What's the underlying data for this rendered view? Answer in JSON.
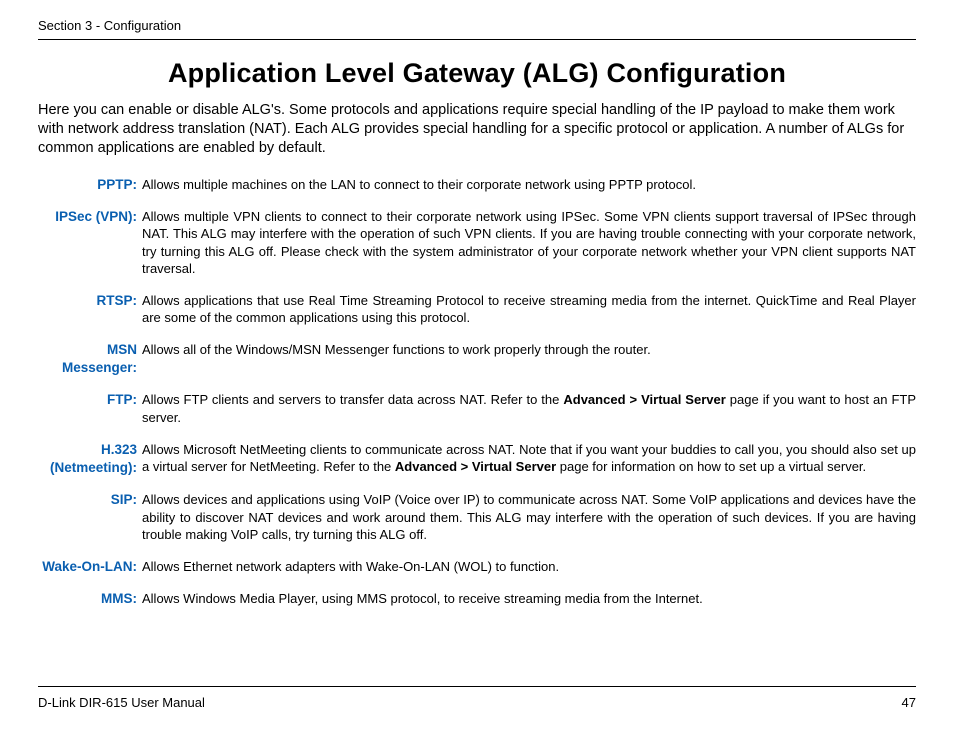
{
  "header": {
    "section": "Section 3 - Configuration"
  },
  "title": "Application Level Gateway (ALG) Configuration",
  "intro": "Here you can enable or disable ALG's. Some protocols and applications require special handling of the IP payload to make them work with network address translation (NAT). Each ALG provides special handling for a specific protocol or application. A number of ALGs for common applications are enabled by default.",
  "items": [
    {
      "label": "PPTP:",
      "desc": "Allows multiple machines on the LAN to connect to their corporate network using PPTP protocol."
    },
    {
      "label": "IPSec (VPN):",
      "desc": "Allows multiple VPN clients to connect to their corporate network using IPSec. Some VPN clients support traversal of IPSec through NAT. This ALG may interfere with the operation of such VPN clients. If you are having trouble connecting with your corporate network, try turning this ALG off. Please check with the system administrator of your corporate network whether your VPN client supports NAT traversal."
    },
    {
      "label": "RTSP:",
      "desc": "Allows applications that use Real Time Streaming Protocol to receive streaming media from the internet. QuickTime and Real Player are some of the common applications using this protocol."
    },
    {
      "label": "MSN Messenger:",
      "desc": "Allows all of the Windows/MSN Messenger functions to work properly through the router."
    },
    {
      "label": "FTP:",
      "desc_html": "Allows FTP clients and servers to transfer data across NAT. Refer to the <b>Advanced > Virtual Server</b> page if you want to host an FTP server."
    },
    {
      "label": "H.323 (Netmeeting):",
      "desc_html": "Allows Microsoft NetMeeting clients to communicate across NAT. Note that if you want your buddies to call you, you should also set up a virtual server for NetMeeting. Refer to the <b>Advanced > Virtual Server</b> page for information on how to set up a virtual server."
    },
    {
      "label": "SIP:",
      "desc": "Allows devices and applications using VoIP (Voice over IP) to communicate across NAT. Some VoIP applications and devices have the ability to discover NAT devices and work around them. This ALG may interfere with the operation of such devices. If you are having trouble making VoIP calls, try turning this ALG off."
    },
    {
      "label": "Wake-On-LAN:",
      "desc": "Allows Ethernet network adapters with Wake-On-LAN (WOL) to function."
    },
    {
      "label": "MMS:",
      "desc": "Allows Windows Media Player, using MMS protocol, to receive streaming media from the Internet."
    }
  ],
  "footer": {
    "manual": "D-Link DIR-615 User Manual",
    "page": "47"
  }
}
